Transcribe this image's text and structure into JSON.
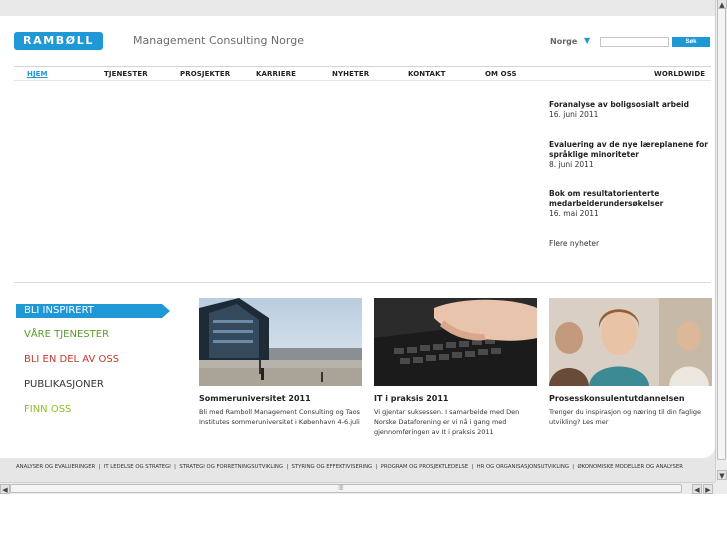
{
  "header": {
    "logo_text": "RAMBØLL",
    "tagline": "Management Consulting Norge",
    "language": "Norge",
    "search_placeholder": "",
    "search_button": "Søk"
  },
  "nav": {
    "items": [
      "HJEM",
      "TJENESTER",
      "PROSJEKTER",
      "KARRIERE",
      "NYHETER",
      "KONTAKT",
      "OM OSS",
      "WORLDWIDE"
    ]
  },
  "news": {
    "items": [
      {
        "title": "Foranalyse av boligsosialt arbeid",
        "date": "16. juni 2011"
      },
      {
        "title": "Evaluering av de nye læreplanene for språklige minoriteter",
        "date": "8. juni 2011"
      },
      {
        "title": "Bok om resultatorienterte medarbeiderundersøkelser",
        "date": "16. mai 2011"
      }
    ],
    "more": "Flere nyheter"
  },
  "left_menu": {
    "items": [
      "BLI INSPIRERT",
      "VÅRE TJENESTER",
      "BLI EN DEL AV OSS",
      "PUBLIKASJONER",
      "FINN OSS"
    ],
    "colors": [
      "#ffffff",
      "#5a9a2e",
      "#c0392b",
      "#333333",
      "#8cbf26"
    ]
  },
  "teasers": [
    {
      "title": "Sommeruniversitet 2011",
      "text": "Bli med Ramboll Management Consulting og Taos Institutes sommeruniversitet i København 4-6.juli"
    },
    {
      "title": "IT i praksis 2011",
      "text": "Vi gjentar suksessen. I samarbeide med Den Norske Dataforening er vi nå i gang med gjennomføringen av It i praksis 2011"
    },
    {
      "title": "Prosesskonsulentutdannelsen",
      "text": "Trenger du inspirasjon og næring til din faglige utvikling? Les mer"
    }
  ],
  "footer": {
    "links": [
      "ANALYSER OG EVALUERINGER",
      "IT LEDELSE OG STRATEGI",
      "STRATEGI OG FORRETNINGSUTVIKLING",
      "STYRING OG EFFEKTIVISERING",
      "PROGRAM OG PROSJEKTLEDELSE",
      "HR OG ORGANISASJONSUTVIKLING",
      "ØKONOMISKE MODELLER OG ANALYSER"
    ]
  }
}
